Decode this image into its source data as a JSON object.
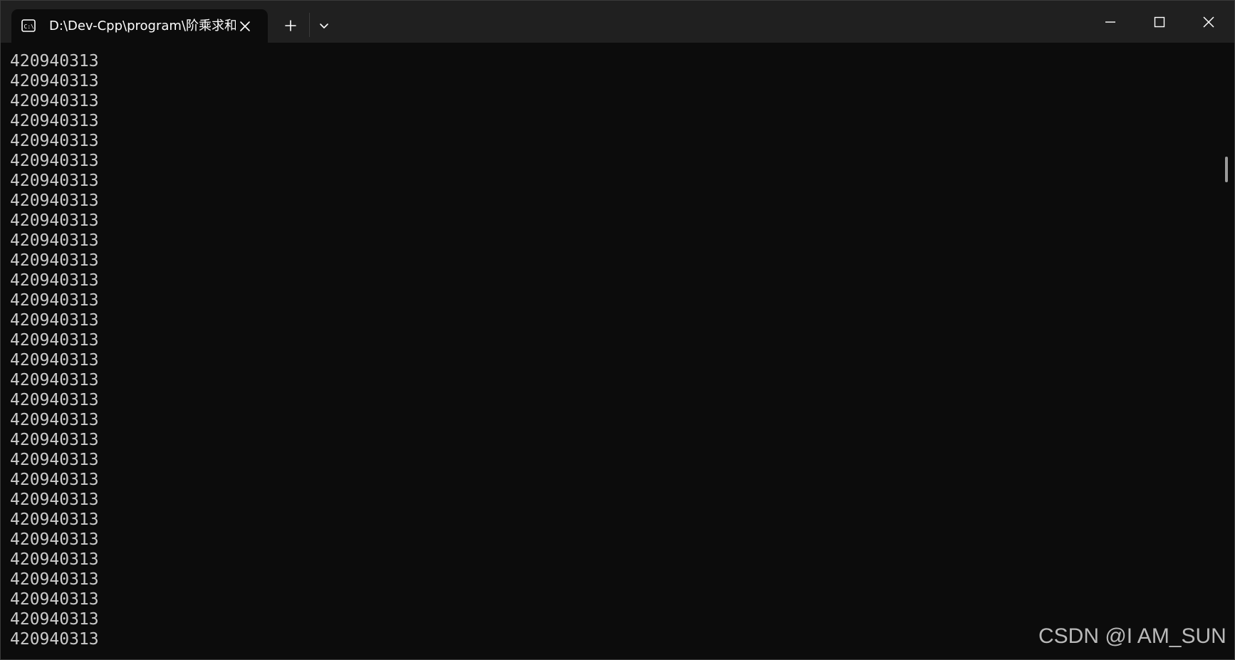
{
  "window": {
    "tab_title": "D:\\Dev-Cpp\\program\\阶乘求和",
    "tab_icon": "terminal-icon",
    "controls": {
      "new_tab_icon": "plus-icon",
      "dropdown_icon": "chevron-down-icon",
      "minimize_icon": "minimize-icon",
      "maximize_icon": "maximize-icon",
      "close_icon": "close-icon"
    }
  },
  "console": {
    "lines": [
      "420940313",
      "420940313",
      "420940313",
      "420940313",
      "420940313",
      "420940313",
      "420940313",
      "420940313",
      "420940313",
      "420940313",
      "420940313",
      "420940313",
      "420940313",
      "420940313",
      "420940313",
      "420940313",
      "420940313",
      "420940313",
      "420940313",
      "420940313",
      "420940313",
      "420940313",
      "420940313",
      "420940313",
      "420940313",
      "420940313",
      "420940313",
      "420940313",
      "420940313",
      "420940313"
    ],
    "text_color": "#cccccc",
    "background_color": "#0c0c0c"
  },
  "watermark": "CSDN @I AM_SUN"
}
